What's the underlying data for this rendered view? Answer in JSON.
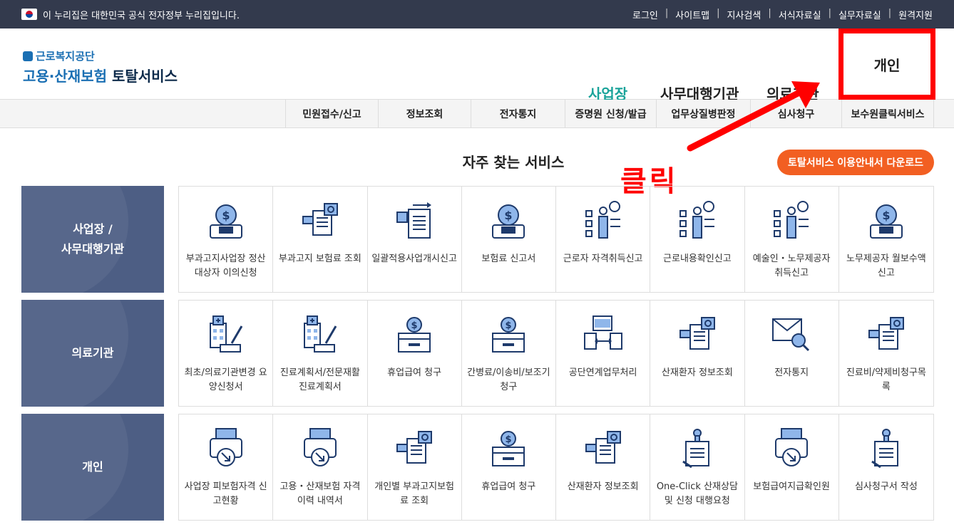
{
  "gov_bar": {
    "text": "이 누리집은 대한민국 공식 전자정부 누리집입니다.",
    "links": [
      "로그인",
      "사이트맵",
      "지사검색",
      "서식자료실",
      "실무자료실",
      "원격지원"
    ]
  },
  "logo": {
    "org": "근로복지공단",
    "service_a": "고용·산재보험",
    "service_b": "토탈서비스"
  },
  "main_nav": [
    "사업장",
    "사무대행기관",
    "의료기관",
    "개인"
  ],
  "sub_nav": [
    "민원접수/신고",
    "정보조회",
    "전자통지",
    "증명원 신청/발급",
    "업무상질병판정",
    "심사청구",
    "보수원클릭서비스"
  ],
  "section_title": "자주 찾는 서비스",
  "download_button": "토탈서비스 이용안내서 다운로드",
  "annotation": "클릭",
  "rows": [
    {
      "category": "사업장 /\n사무대행기관",
      "cards": [
        {
          "label": "부과고지사업장 정산대상자 이의신청",
          "icon": "coin-card-icon"
        },
        {
          "label": "부과고지 보험료 조회",
          "icon": "document-search-icon"
        },
        {
          "label": "일괄적용사업개시신고",
          "icon": "document-transfer-icon"
        },
        {
          "label": "보험료 신고서",
          "icon": "coin-card-icon"
        },
        {
          "label": "근로자 자격취득신고",
          "icon": "checklist-person-icon"
        },
        {
          "label": "근로내용확인신고",
          "icon": "checklist-person-icon"
        },
        {
          "label": "예술인・노무제공자 취득신고",
          "icon": "checklist-person-icon"
        },
        {
          "label": "노무제공자 월보수액 신고",
          "icon": "coin-card-icon"
        }
      ]
    },
    {
      "category": "의료기관",
      "cards": [
        {
          "label": "최초/의료기관변경 요양신청서",
          "icon": "hospital-pen-icon"
        },
        {
          "label": "진료계획서/전문재활진료계획서",
          "icon": "hospital-pen-icon"
        },
        {
          "label": "휴업급여 청구",
          "icon": "coin-box-icon"
        },
        {
          "label": "간병료/이송비/보조기 청구",
          "icon": "coin-box-icon"
        },
        {
          "label": "공단연계업무처리",
          "icon": "folder-exchange-icon"
        },
        {
          "label": "산재환자 정보조회",
          "icon": "document-search-icon"
        },
        {
          "label": "전자통지",
          "icon": "mail-search-icon"
        },
        {
          "label": "진료비/약제비청구목록",
          "icon": "document-search-icon"
        }
      ]
    },
    {
      "category": "개인",
      "cards": [
        {
          "label": "사업장 피보험자격 신고현황",
          "icon": "printer-arrow-icon"
        },
        {
          "label": "고용・산재보험 자격 이력 내역서",
          "icon": "printer-arrow-icon"
        },
        {
          "label": "개인별 부과고지보험료 조회",
          "icon": "document-search-icon"
        },
        {
          "label": "휴업급여 청구",
          "icon": "coin-box-icon"
        },
        {
          "label": "산재환자 정보조회",
          "icon": "document-search-icon"
        },
        {
          "label": "One-Click 산재상담 및 신청 대행요청",
          "icon": "stamp-document-icon"
        },
        {
          "label": "보험급여지급확인원",
          "icon": "printer-arrow-icon"
        },
        {
          "label": "심사청구서 작성",
          "icon": "stamp-document-icon"
        }
      ]
    }
  ],
  "colors": {
    "gov_bar": "#333a4d",
    "accent": "#1aa39a",
    "category_bg": "#4d5e84",
    "download": "#f25f22",
    "highlight": "#ff0000"
  }
}
